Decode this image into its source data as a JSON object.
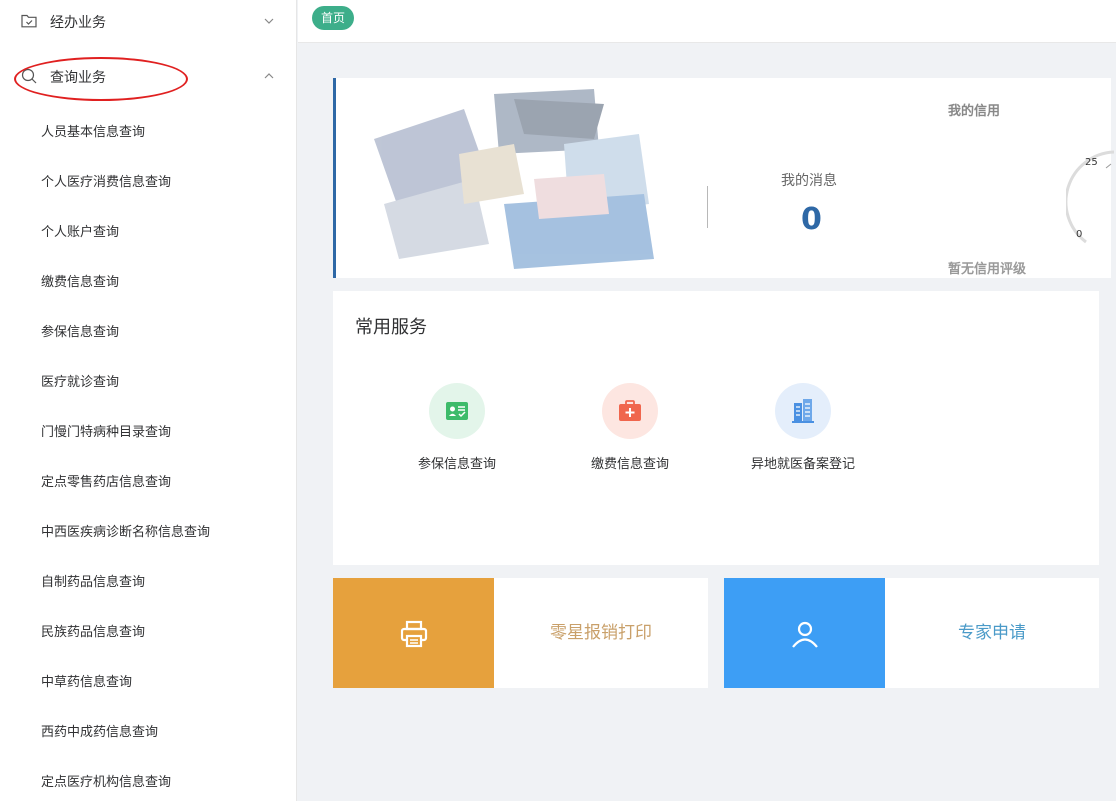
{
  "sidebar": {
    "groups": [
      {
        "label": "经办业务",
        "icon": "folder-check-icon",
        "expanded": false
      },
      {
        "label": "查询业务",
        "icon": "search-icon",
        "expanded": true
      }
    ],
    "items": [
      "人员基本信息查询",
      "个人医疗消费信息查询",
      "个人账户查询",
      "缴费信息查询",
      "参保信息查询",
      "医疗就诊查询",
      "门慢门特病种目录查询",
      "定点零售药店信息查询",
      "中西医疾病诊断名称信息查询",
      "自制药品信息查询",
      "民族药品信息查询",
      "中草药信息查询",
      "西药中成药信息查询",
      "定点医疗机构信息查询"
    ]
  },
  "topbar": {
    "home_tag": "首页"
  },
  "info": {
    "message_label": "我的消息",
    "message_count": "0",
    "credit_title": "我的信用",
    "credit_none": "暂无信用评级",
    "gauge_tick_high": "25",
    "gauge_tick_low": "0"
  },
  "services": {
    "title": "常用服务",
    "items": [
      {
        "label": "参保信息查询",
        "icon": "insurance-card-icon",
        "color": "#3dbb6a"
      },
      {
        "label": "缴费信息查询",
        "icon": "medical-kit-icon",
        "color": "#f0664d"
      },
      {
        "label": "异地就医备案登记",
        "icon": "building-icon",
        "color": "#4a90e2"
      }
    ]
  },
  "tiles": [
    {
      "label": "零星报销打印",
      "icon": "printer-icon",
      "color": "#e6a13d"
    },
    {
      "label": "专家申请",
      "icon": "user-icon",
      "color": "#3d9ef5"
    }
  ],
  "colors": {
    "accent": "#2e68a6",
    "home_tag": "#3dae8a",
    "annotation": "#e02020"
  }
}
